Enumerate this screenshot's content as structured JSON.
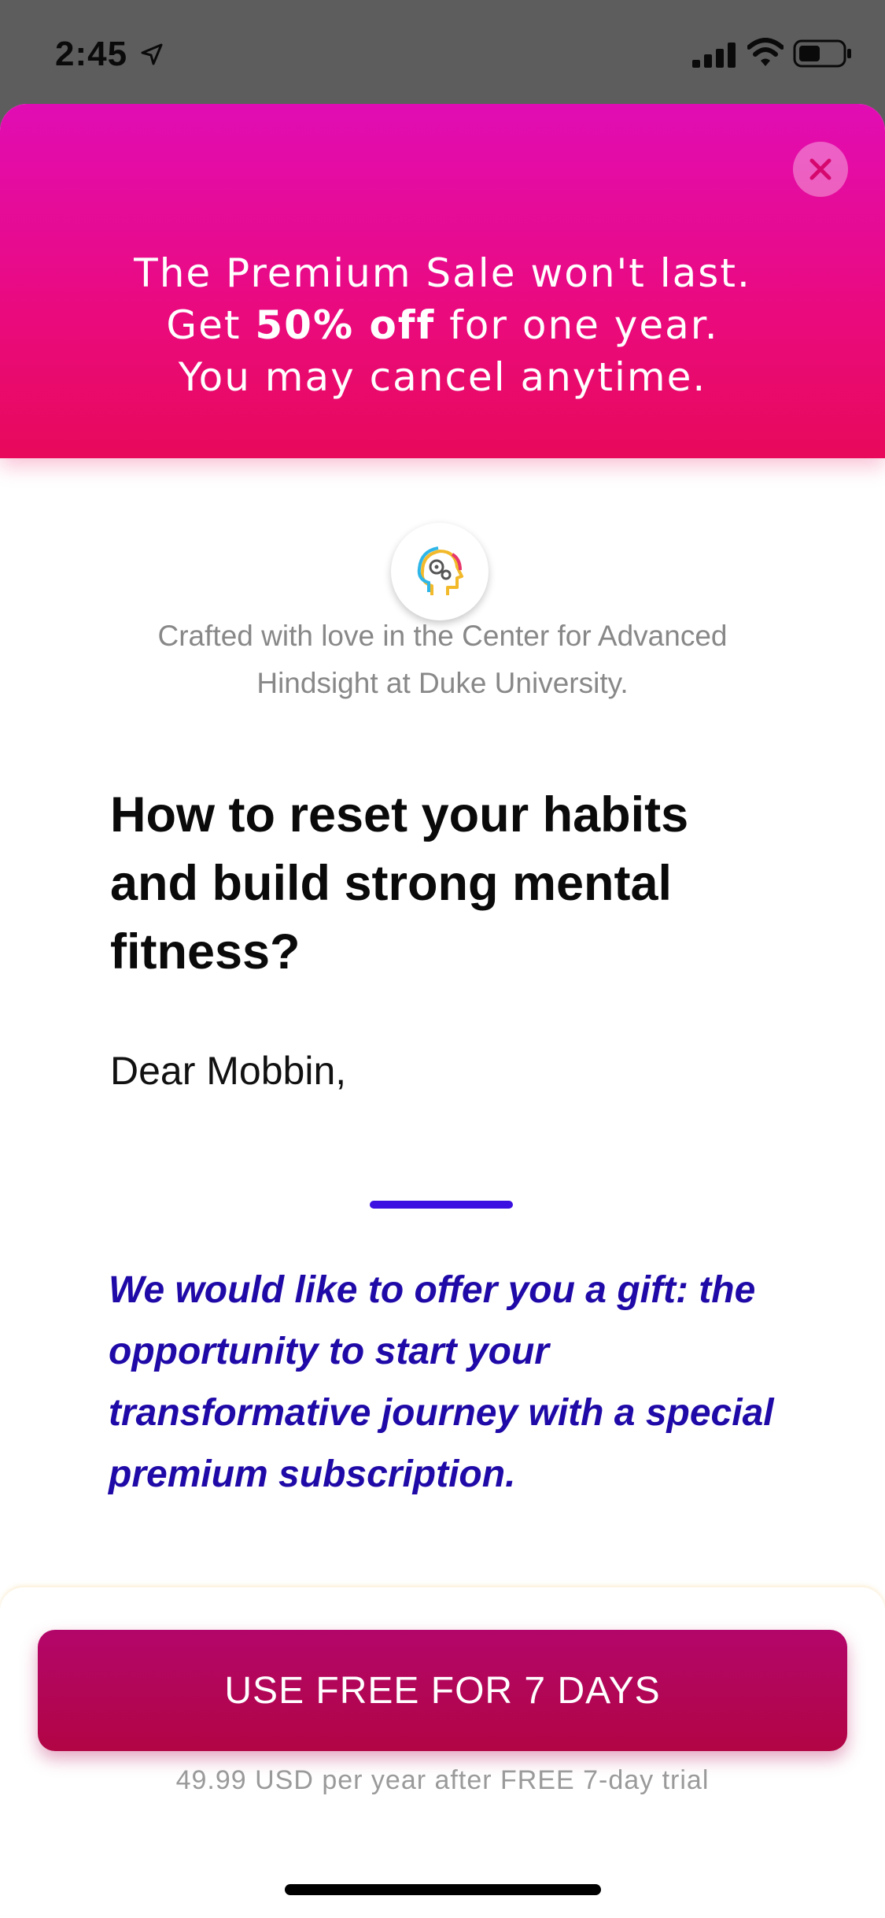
{
  "status_bar": {
    "time": "2:45",
    "icons": [
      "location-arrow-icon",
      "cellular-signal-icon",
      "wifi-icon",
      "battery-icon"
    ]
  },
  "promo": {
    "line1": "The Premium Sale won't last.",
    "line2_prefix": "Get ",
    "line2_bold": "50% off",
    "line2_suffix": " for one year.",
    "line3": "You may cancel anytime.",
    "close_icon": "close-icon"
  },
  "credit": {
    "line1": "Crafted with love in the Center for Advanced",
    "line2": "Hindsight at Duke University."
  },
  "headline": {
    "line1": "How to reset your habits",
    "line2": "and build strong mental",
    "line3": "fitness?"
  },
  "greeting": "Dear Mobbin,",
  "gift": {
    "line1": "We would like to offer you a gift: the",
    "line2": "opportunity to start your",
    "line3": "transformative journey with a special",
    "line4": "premium subscription."
  },
  "cta": {
    "label": "USE FREE FOR 7 DAYS",
    "price_note": "49.99 USD per year after FREE 7-day trial"
  },
  "colors": {
    "banner_top": "#e10db4",
    "banner_bottom": "#e8095b",
    "accent_blue": "#3b10e0",
    "gift_text": "#1f0aa8",
    "cta": "#b20545"
  }
}
